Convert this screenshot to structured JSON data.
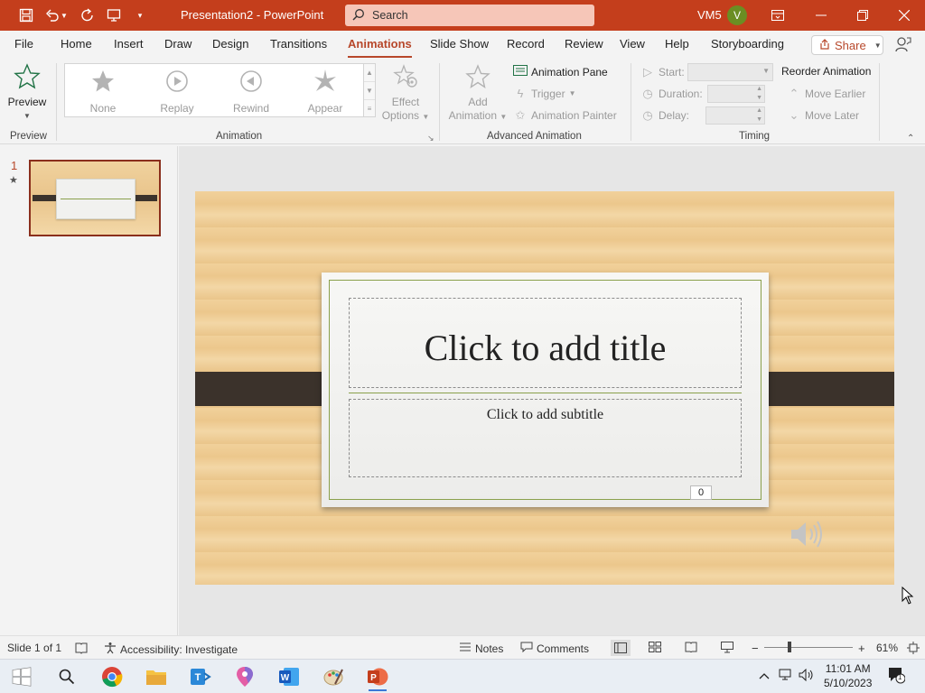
{
  "app": {
    "title": "Presentation2  -  PowerPoint",
    "search_placeholder": "Search",
    "user_initials": "VM5",
    "avatar_letter": "V",
    "accent_color": "#c43e1c"
  },
  "quick_access": [
    "save-icon",
    "undo-icon",
    "redo-icon",
    "present-icon",
    "customize-icon"
  ],
  "tabs": [
    {
      "label": "File"
    },
    {
      "label": "Home"
    },
    {
      "label": "Insert"
    },
    {
      "label": "Draw"
    },
    {
      "label": "Design"
    },
    {
      "label": "Transitions"
    },
    {
      "label": "Animations"
    },
    {
      "label": "Slide Show"
    },
    {
      "label": "Record"
    },
    {
      "label": "Review"
    },
    {
      "label": "View"
    },
    {
      "label": "Help"
    },
    {
      "label": "Storyboarding"
    }
  ],
  "active_tab": "Animations",
  "share_label": "Share",
  "ribbon": {
    "preview": {
      "label": "Preview",
      "group": "Preview"
    },
    "animation": {
      "group": "Animation",
      "items": [
        {
          "label": "None"
        },
        {
          "label": "Replay"
        },
        {
          "label": "Rewind"
        },
        {
          "label": "Appear"
        }
      ],
      "effect_options_line1": "Effect",
      "effect_options_line2": "Options"
    },
    "advanced": {
      "group": "Advanced Animation",
      "add_animation_line1": "Add",
      "add_animation_line2": "Animation",
      "animation_pane": "Animation Pane",
      "trigger": "Trigger",
      "animation_painter": "Animation Painter"
    },
    "timing": {
      "group": "Timing",
      "start": "Start:",
      "duration": "Duration:",
      "delay": "Delay:",
      "reorder": "Reorder Animation",
      "move_earlier": "Move Earlier",
      "move_later": "Move Later"
    }
  },
  "thumbnails": [
    {
      "number": "1",
      "has_animation": "★"
    }
  ],
  "slide": {
    "title_placeholder": "Click to add title",
    "subtitle_placeholder": "Click to add subtitle",
    "slide_number": "0"
  },
  "status": {
    "slide_of": "Slide 1 of 1",
    "accessibility": "Accessibility: Investigate",
    "notes": "Notes",
    "comments": "Comments",
    "zoom": "61%"
  },
  "taskbar": {
    "apps": [
      "windows-start",
      "search",
      "chrome",
      "file-explorer",
      "teams",
      "maps",
      "word",
      "paint",
      "powerpoint"
    ],
    "time": "11:01 AM",
    "date": "5/10/2023",
    "notification_count": "1"
  }
}
